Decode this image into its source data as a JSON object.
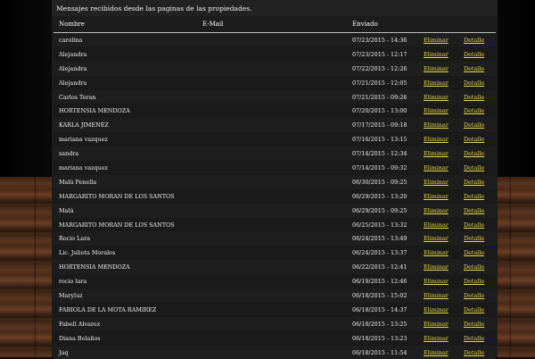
{
  "intro_text": "Mensajes recibidos desde las paginas de las propiedades.",
  "columns": {
    "name": "Nombre",
    "email": "E-Mail",
    "sent": "Enviado"
  },
  "action_delete": "Eliminar",
  "action_detail": "Detalle",
  "colors": {
    "link": "#e8d84a",
    "panel": "#1c1c1c",
    "text": "#f2f2f2"
  },
  "rows": [
    {
      "name": "carolina",
      "email": "",
      "sent": "07/23/2015 - 14:36"
    },
    {
      "name": "Alejandra",
      "email": "",
      "sent": "07/23/2015 - 12:17"
    },
    {
      "name": "Alejandra",
      "email": "",
      "sent": "07/22/2015 - 12:26"
    },
    {
      "name": "Alejandra",
      "email": "",
      "sent": "07/21/2015 - 12:05"
    },
    {
      "name": "Carlos Teran",
      "email": "",
      "sent": "07/21/2015 - 09:26"
    },
    {
      "name": "HORTENSIA MENDOZA",
      "email": "",
      "sent": "07/20/2015 - 13:00"
    },
    {
      "name": "KARLA JIMENEZ",
      "email": "",
      "sent": "07/17/2015 - 09:18"
    },
    {
      "name": "mariana vazquez",
      "email": "",
      "sent": "07/16/2015 - 13:15"
    },
    {
      "name": "sandra",
      "email": "",
      "sent": "07/14/2015 - 12:34"
    },
    {
      "name": "mariana vazquez",
      "email": "",
      "sent": "07/14/2015 - 09:32"
    },
    {
      "name": "Malú Penella",
      "email": "",
      "sent": "06/30/2015 - 09:25"
    },
    {
      "name": "MARGARITO MORAN DE LOS SANTOS",
      "email": "",
      "sent": "06/29/2015 - 13:20"
    },
    {
      "name": "Malú",
      "email": "",
      "sent": "06/29/2015 - 09:25"
    },
    {
      "name": "MARGARITO MORAN DE LOS SANTOS",
      "email": "",
      "sent": "06/25/2015 - 13:32"
    },
    {
      "name": "Rocio Lara",
      "email": "",
      "sent": "06/24/2015 - 13:49"
    },
    {
      "name": "Lic. Julieta Morales",
      "email": "",
      "sent": "06/24/2015 - 13:37"
    },
    {
      "name": "HORTENSIA MENDOZA",
      "email": "",
      "sent": "06/22/2015 - 12:41"
    },
    {
      "name": "rocio lara",
      "email": "",
      "sent": "06/19/2015 - 12:46"
    },
    {
      "name": "Maryluz",
      "email": "",
      "sent": "06/18/2015 - 15:02"
    },
    {
      "name": "FABIOLA DE LA MOTA RAMIREZ",
      "email": "",
      "sent": "06/18/2015 - 14:37"
    },
    {
      "name": "Fabell Alvarez",
      "email": "",
      "sent": "06/18/2015 - 13:25"
    },
    {
      "name": "Diana Bolaños",
      "email": "",
      "sent": "06/18/2015 - 13:23"
    },
    {
      "name": "Jaq",
      "email": "",
      "sent": "06/18/2015 - 11:54"
    }
  ]
}
